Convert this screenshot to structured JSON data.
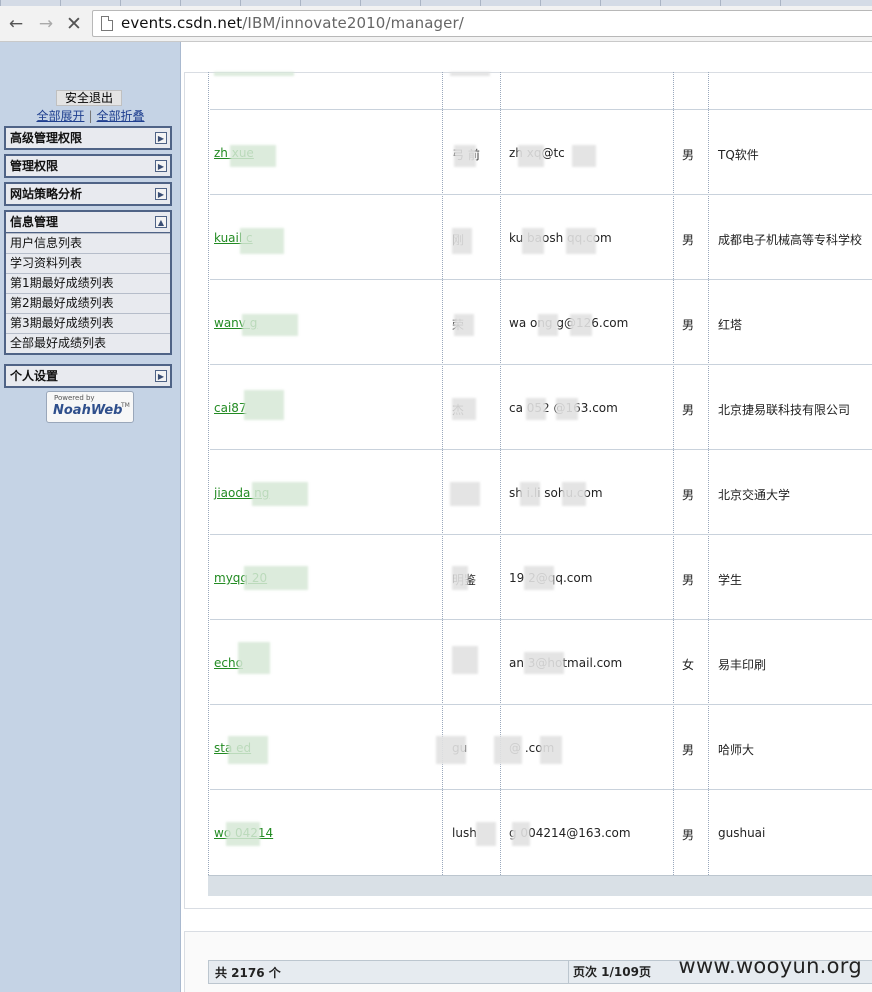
{
  "browser": {
    "url_host": "events.csdn.net",
    "url_path": "/IBM/innovate2010/manager/"
  },
  "sidebar": {
    "logout_label": "安全退出",
    "expand_all": "全部展开",
    "separator": "|",
    "collapse_all": "全部折叠",
    "menus": [
      {
        "label": "高级管理权限",
        "arrow": "▶"
      },
      {
        "label": "管理权限",
        "arrow": "▶"
      },
      {
        "label": "网站策略分析",
        "arrow": "▶"
      },
      {
        "label": "信息管理",
        "arrow": "▲"
      },
      {
        "label": "个人设置",
        "arrow": "▶"
      }
    ],
    "submenu": [
      "用户信息列表",
      "学习资料列表",
      "第1期最好成绩列表",
      "第2期最好成绩列表",
      "第3期最好成绩列表",
      "全部最好成绩列表"
    ],
    "badge": {
      "powered": "Powered by",
      "name": "NoahWeb",
      "tm": "TM"
    }
  },
  "table": {
    "rows": [
      {
        "user": "zh   xue  ",
        "name": "弓   前",
        "email": "zh    xq@tc",
        "gender": "男",
        "org": "TQ软件"
      },
      {
        "user": "kuail   c",
        "name": "   刚",
        "email": "ku   baosh   qq.com",
        "gender": "男",
        "org": "成都电子机械高等专科学校"
      },
      {
        "user": "wanv    g",
        "name": "   荣",
        "email": "wa   ong    g@126.com",
        "gender": "男",
        "org": "红塔"
      },
      {
        "user": "cai87",
        "name": "   杰",
        "email": "ca   052   @163.com",
        "gender": "男",
        "org": "北京捷易联科技有限公司"
      },
      {
        "user": "jiaoda        ng",
        "name": "",
        "email": "sh   i.li   sohu.com",
        "gender": "男",
        "org": "北京交通大学"
      },
      {
        "user": "myqq        20",
        "name": "   明鉴",
        "email": "19     2@qq.com",
        "gender": "男",
        "org": "学生"
      },
      {
        "user": "echo",
        "name": "",
        "email": "an      3@hotmail.com",
        "gender": "女",
        "org": "易丰印刷"
      },
      {
        "user": "sta   ed",
        "name": "gu",
        "email": "     @     .com",
        "gender": "男",
        "org": "哈师大"
      },
      {
        "user": "wo    04214",
        "name": "lush",
        "email": "    g   004214@163.com",
        "gender": "男",
        "org": "gushuai"
      }
    ]
  },
  "footer": {
    "total": "共 2176 个",
    "pages": "页次 1/109页"
  },
  "watermark": "www.wooyun.org"
}
